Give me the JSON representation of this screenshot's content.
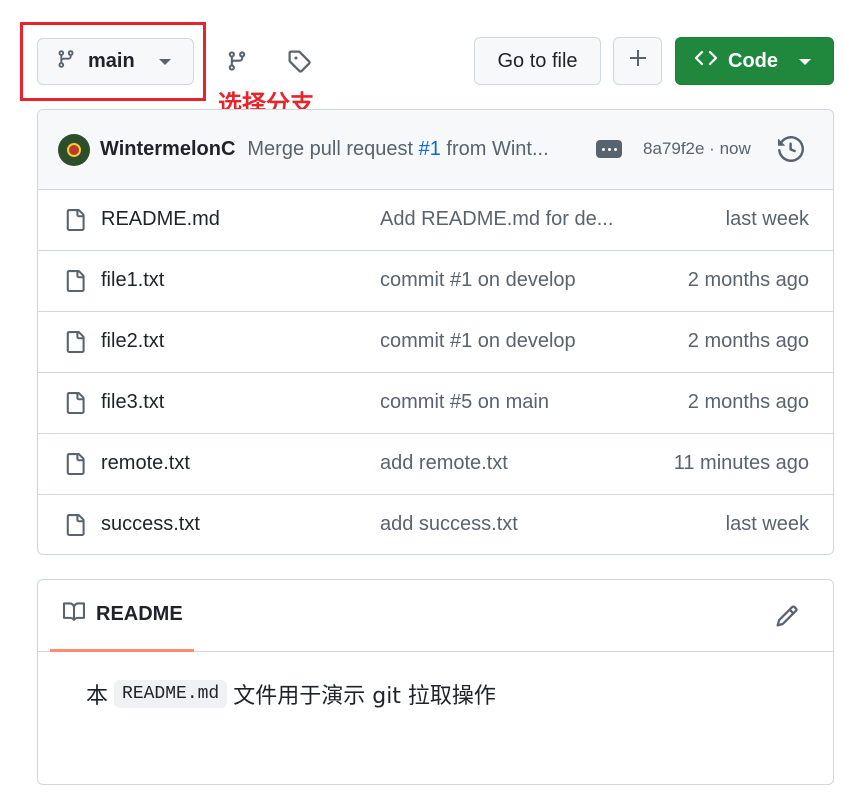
{
  "toolbar": {
    "branch_label": "main",
    "annotation": "选择分支",
    "goto_label": "Go to file",
    "code_label": "Code"
  },
  "commit": {
    "author": "WintermelonC",
    "message_prefix": "Merge pull request ",
    "message_link": "#1",
    "message_suffix": " from Wint...",
    "hash": "8a79f2e",
    "time": "now"
  },
  "files": [
    {
      "name": "README.md",
      "message": "Add README.md for de...",
      "time": "last week"
    },
    {
      "name": "file1.txt",
      "message": "commit #1 on develop",
      "time": "2 months ago"
    },
    {
      "name": "file2.txt",
      "message": "commit #1 on develop",
      "time": "2 months ago"
    },
    {
      "name": "file3.txt",
      "message": "commit #5 on main",
      "time": "2 months ago"
    },
    {
      "name": "remote.txt",
      "message": "add remote.txt",
      "time": "11 minutes ago"
    },
    {
      "name": "success.txt",
      "message": "add success.txt",
      "time": "last week"
    }
  ],
  "readme": {
    "tab_label": "README",
    "text_before": "本",
    "code": "README.md",
    "text_after": "文件用于演示 git 拉取操作"
  },
  "colors": {
    "accent_green": "#1f883d",
    "highlight_red": "#e5242b",
    "link_blue": "#0969da",
    "tab_underline": "#fd8c73"
  },
  "icons": [
    "git-branch-icon",
    "caret-down-icon",
    "branches-icon",
    "tag-icon",
    "plus-icon",
    "code-icon",
    "kebab-icon",
    "history-icon",
    "file-icon",
    "book-icon",
    "pencil-icon"
  ]
}
